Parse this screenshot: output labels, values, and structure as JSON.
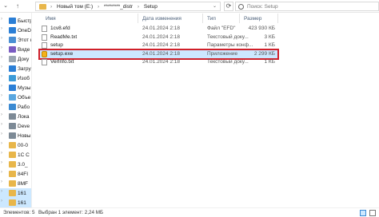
{
  "address": {
    "segments": [
      "Новый том (E:)",
      "********_distr",
      "Setup"
    ],
    "separator": "›",
    "search_placeholder": "Поиск: Setup"
  },
  "sidebar": {
    "items": [
      {
        "label": "Быстр",
        "icon": "star-icon",
        "color": "#2b7fd6"
      },
      {
        "label": "OneDr",
        "icon": "cloud-icon",
        "color": "#2b7fd6"
      },
      {
        "label": "Этот к",
        "icon": "computer-icon",
        "color": "#4a8fd3"
      },
      {
        "label": "Виде",
        "icon": "video-icon",
        "color": "#7a5cc2"
      },
      {
        "label": "Доку",
        "icon": "document-icon",
        "color": "#9aa6b2"
      },
      {
        "label": "Загру",
        "icon": "download-icon",
        "color": "#2b7fd6"
      },
      {
        "label": "Изоб",
        "icon": "pictures-icon",
        "color": "#3c9bd8"
      },
      {
        "label": "Музы",
        "icon": "music-icon",
        "color": "#2b7fd6"
      },
      {
        "label": "Объе",
        "icon": "3d-objects-icon",
        "color": "#5aa7e0"
      },
      {
        "label": "Рабо",
        "icon": "desktop-icon",
        "color": "#3b8ad2"
      },
      {
        "label": "Лока",
        "icon": "drive-icon",
        "color": "#7d8a96"
      },
      {
        "label": "Deve",
        "icon": "drive-icon",
        "color": "#7d8a96"
      },
      {
        "label": "Новы",
        "icon": "drive-icon",
        "color": "#7d8a96"
      },
      {
        "label": "00-0",
        "icon": "folder-icon",
        "color": "#e8b64a"
      },
      {
        "label": "1С С",
        "icon": "folder-icon",
        "color": "#e8b64a"
      },
      {
        "label": "3.0_",
        "icon": "folder-icon",
        "color": "#e8b64a"
      },
      {
        "label": "84FI",
        "icon": "folder-icon",
        "color": "#e8b64a"
      },
      {
        "label": "8MF",
        "icon": "folder-icon",
        "color": "#e8b64a"
      },
      {
        "label": "161",
        "icon": "folder-icon",
        "color": "#e8b64a"
      },
      {
        "label": "161",
        "icon": "folder-icon",
        "color": "#e8b64a"
      }
    ]
  },
  "columns": {
    "name": "Имя",
    "date": "Дата изменения",
    "type": "Тип",
    "size": "Размер"
  },
  "files": [
    {
      "name": "1cv8.efd",
      "date": "24.01.2024 2:18",
      "type": "Файл \"EFD\"",
      "size": "423 930 КБ",
      "icon": "file-icon",
      "selected": false
    },
    {
      "name": "ReadMe.txt",
      "date": "24.01.2024 2:18",
      "type": "Текстовый доку...",
      "size": "3 КБ",
      "icon": "text-file-icon",
      "selected": false
    },
    {
      "name": "setup",
      "date": "24.01.2024 2:18",
      "type": "Параметры конф...",
      "size": "1 КБ",
      "icon": "settings-file-icon",
      "selected": false
    },
    {
      "name": "setup.exe",
      "date": "24.01.2024 2:18",
      "type": "Приложение",
      "size": "2 299 КБ",
      "icon": "exe-icon",
      "selected": true
    },
    {
      "name": "VerInfo.txt",
      "date": "24.01.2024 2:18",
      "type": "Текстовый доку...",
      "size": "1 КБ",
      "icon": "text-file-icon",
      "selected": false
    }
  ],
  "status": {
    "elements": "Элементов: 5",
    "selection": "Выбран 1 элемент: 2,24 МБ"
  },
  "colors": {
    "selection_bg": "#cce8ff",
    "highlight_border": "#d0202a",
    "folder": "#e8b64a"
  }
}
